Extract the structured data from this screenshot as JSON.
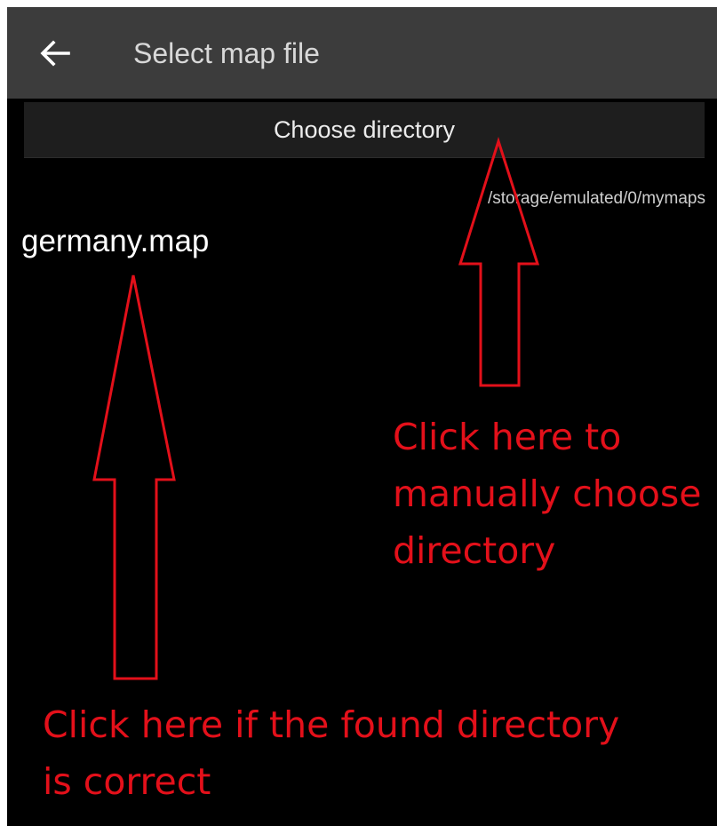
{
  "app_bar": {
    "back_icon": "arrow-left-icon",
    "title": "Select map file"
  },
  "choose_directory": {
    "label": "Choose directory"
  },
  "current_path": "/storage/emulated/0/mymaps",
  "files": [
    {
      "name": "germany.map"
    }
  ],
  "annotations": {
    "color": "#e3101a",
    "manual": {
      "lines": [
        "Click here to",
        "manually choose",
        "directory"
      ]
    },
    "found": {
      "lines": [
        "Click here if the found directory",
        "is correct"
      ]
    }
  }
}
